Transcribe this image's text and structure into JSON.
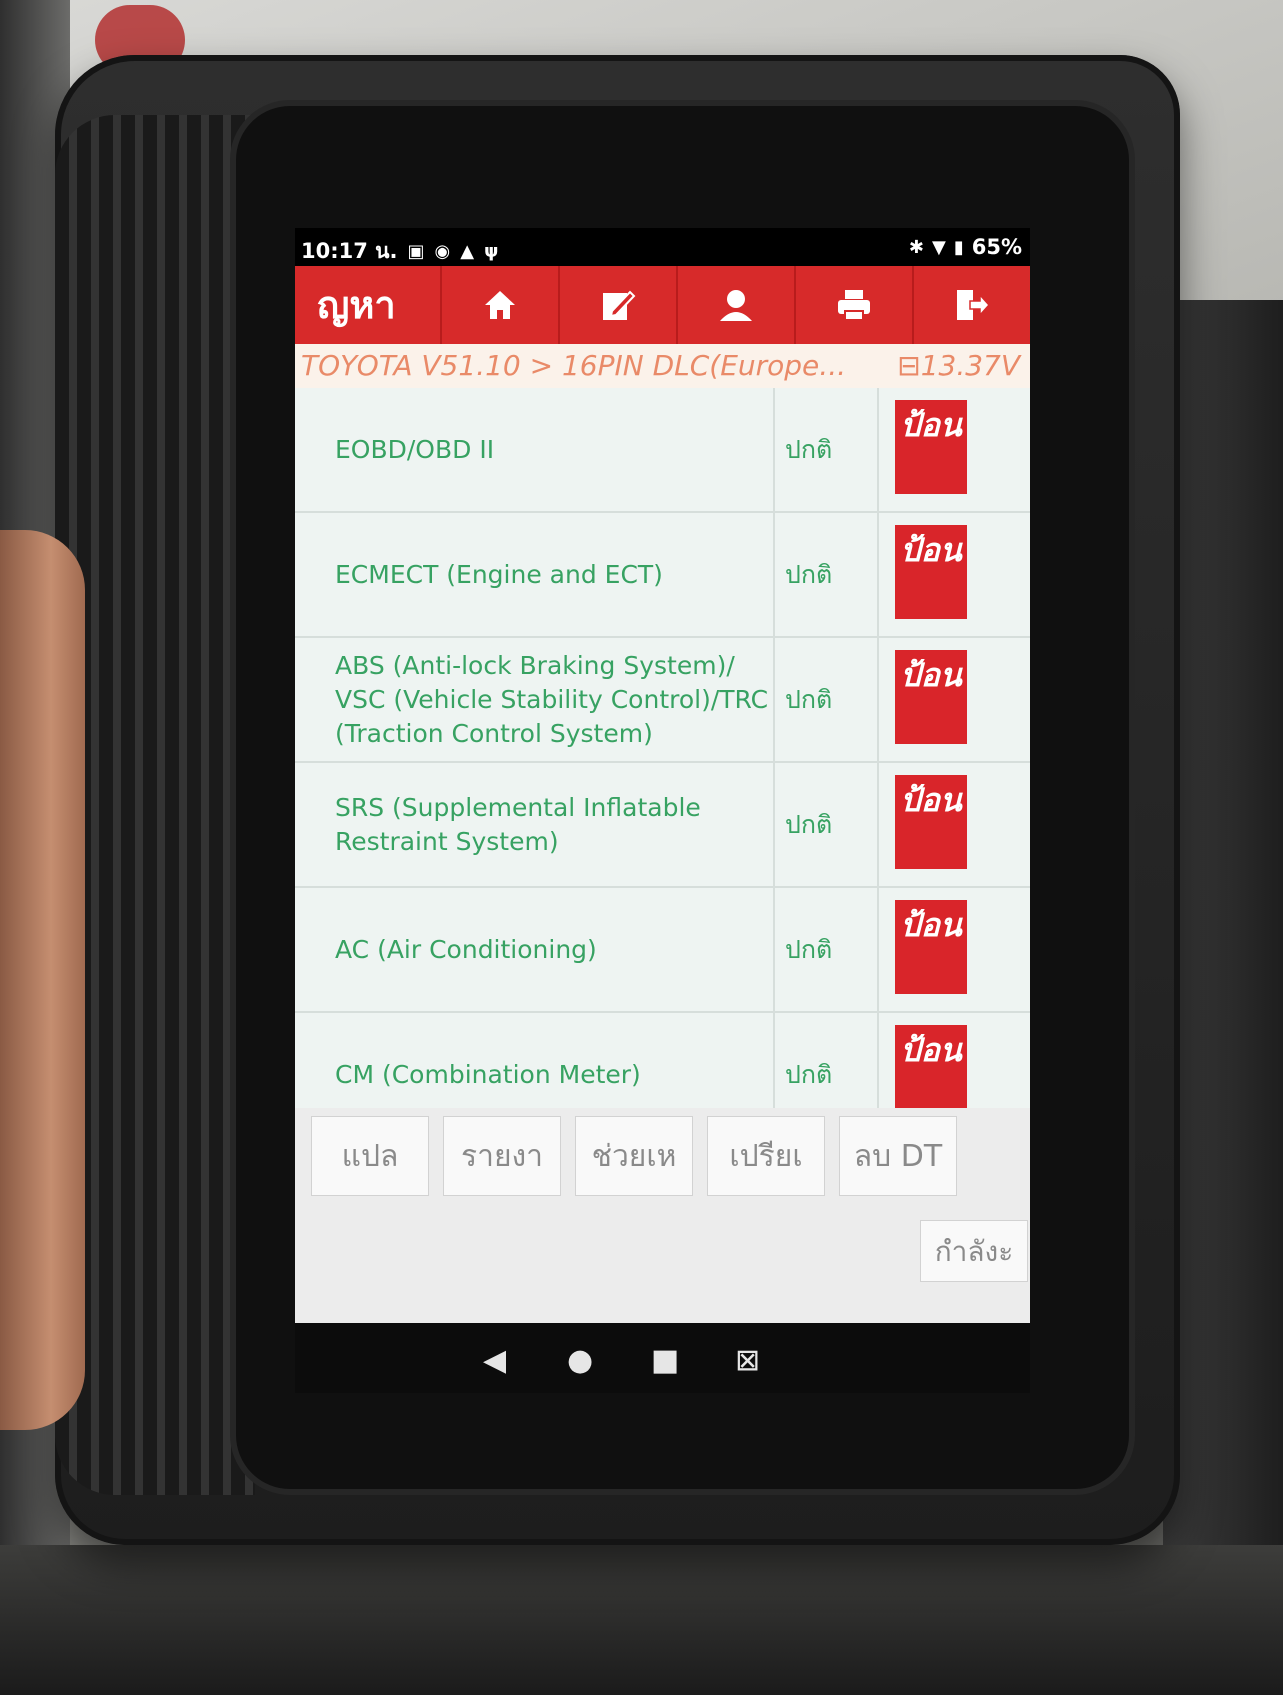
{
  "statusbar": {
    "time": "10:17 น.",
    "left_icons": [
      "calendar-icon",
      "notification-icon",
      "warning-icon",
      "usb-icon"
    ],
    "right_icons": [
      "bluetooth-icon",
      "wifi-icon",
      "battery-icon"
    ],
    "battery": "65%"
  },
  "toolbar": {
    "title": "ญหา",
    "buttons": [
      {
        "name": "home-icon"
      },
      {
        "name": "edit-report-icon"
      },
      {
        "name": "user-icon"
      },
      {
        "name": "print-icon"
      },
      {
        "name": "exit-icon"
      }
    ]
  },
  "breadcrumb": {
    "path": "TOYOTA V51.10 > 16PIN DLC(Europe...",
    "voltage": "13.37V"
  },
  "systems": [
    {
      "name": "EOBD/OBD II",
      "status": "ปกติ",
      "button": "ป้อน"
    },
    {
      "name": "ECMECT (Engine and ECT)",
      "status": "ปกติ",
      "button": "ป้อน"
    },
    {
      "name": "ABS (Anti-lock Braking System)/ VSC (Vehicle Stability Control)/TRC (Traction Control System)",
      "status": "ปกติ",
      "button": "ป้อน"
    },
    {
      "name": "SRS (Supplemental Inflatable Restraint System)",
      "status": "ปกติ",
      "button": "ป้อน"
    },
    {
      "name": "AC (Air Conditioning)",
      "status": "ปกติ",
      "button": "ป้อน"
    },
    {
      "name": "CM (Combination Meter)",
      "status": "ปกติ",
      "button": "ป้อน"
    }
  ],
  "actions": [
    "แปล",
    "รายงา",
    "ช่วยเห",
    "เปรียเ",
    "ลบ DT"
  ],
  "progress_button": "กำลังะ",
  "colors": {
    "accent_red": "#d72a2a",
    "text_green": "#37a262",
    "breadcrumb_orange": "#e98a68"
  }
}
